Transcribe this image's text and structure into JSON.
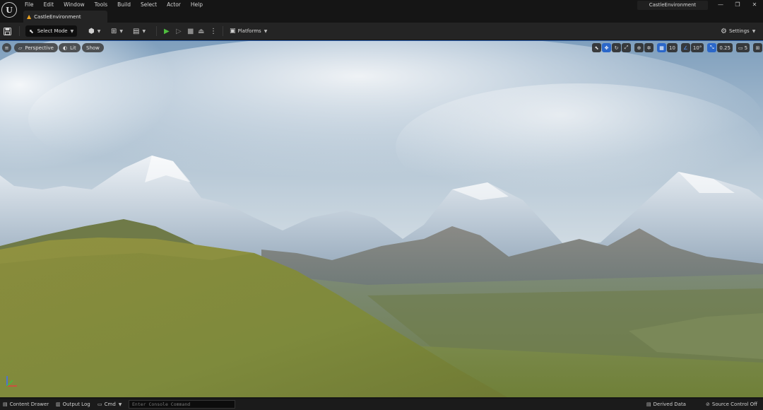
{
  "menu": [
    "File",
    "Edit",
    "Window",
    "Tools",
    "Build",
    "Select",
    "Actor",
    "Help"
  ],
  "level_tab": {
    "label": "CastleEnvironment",
    "icon": "level-icon"
  },
  "project_name": "CastleEnvironment",
  "window_controls": {
    "minimize": "—",
    "restore": "❐",
    "close": "✕"
  },
  "toolbar": {
    "mode_label": "Select Mode",
    "platforms_label": "Platforms",
    "settings_label": "Settings"
  },
  "viewport": {
    "view_mode": "Perspective",
    "lighting": "Lit",
    "show_label": "Show",
    "grid_snap": "10",
    "rotation_snap": "10°",
    "scale_snap": "0.25",
    "camera_speed": "5"
  },
  "statusbar": {
    "content_drawer": "Content Drawer",
    "output_log": "Output Log",
    "cmd": "Cmd",
    "console_placeholder": "Enter Console Command",
    "derived_data": "Derived Data",
    "source_control": "Source Control Off"
  },
  "colors": {
    "accent": "#2b67c9",
    "play": "#4fbf3f",
    "sky_top": "#7f9fbd",
    "grass": "#7e8a3c"
  }
}
